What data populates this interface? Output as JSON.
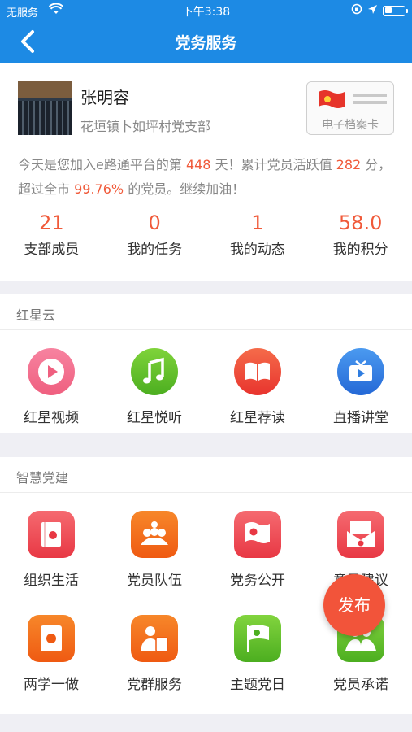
{
  "status_bar": {
    "carrier": "无服务",
    "time": "下午3:38"
  },
  "nav": {
    "title": "党务服务"
  },
  "profile": {
    "name": "张明容",
    "branch": "花垣镇卜如坪村党支部",
    "dossier_label": "电子档案卡",
    "intro": {
      "p1": "今天是您加入e路通平台的第 ",
      "days": "448",
      "p2": " 天！累计党员活跃值 ",
      "score": "282",
      "p3": " 分，超过全市 ",
      "percent": "99.76%",
      "p4": " 的党员。继续加油！"
    },
    "stats": [
      {
        "value": "21",
        "label": "支部成员"
      },
      {
        "value": "0",
        "label": "我的任务"
      },
      {
        "value": "1",
        "label": "我的动态"
      },
      {
        "value": "58.0",
        "label": "我的积分"
      }
    ]
  },
  "sections": {
    "red_star_cloud": {
      "title": "红星云",
      "items": [
        {
          "label": "红星视频",
          "icon": "video-play-icon",
          "color": "#f26a8a"
        },
        {
          "label": "红星悦听",
          "icon": "music-note-icon",
          "color": "#5bbf2b"
        },
        {
          "label": "红星荐读",
          "icon": "open-book-icon",
          "color": "#f0463a"
        },
        {
          "label": "直播讲堂",
          "icon": "tv-live-icon",
          "color": "#2f7de0"
        }
      ]
    },
    "smart_party": {
      "title": "智慧党建",
      "items": [
        {
          "label": "组织生活",
          "icon": "party-book-icon",
          "color": "#f04a55"
        },
        {
          "label": "党员队伍",
          "icon": "party-members-icon",
          "color": "#f26a1a"
        },
        {
          "label": "党务公开",
          "icon": "party-flag-icon",
          "color": "#f04a55"
        },
        {
          "label": "意见建议",
          "icon": "suggestion-mail-icon",
          "color": "#f04a55"
        },
        {
          "label": "两学一做",
          "icon": "study-book-icon",
          "color": "#f26a1a"
        },
        {
          "label": "党群服务",
          "icon": "service-person-icon",
          "color": "#f26a1a"
        },
        {
          "label": "主题党日",
          "icon": "green-flag-icon",
          "color": "#5bbf2b"
        },
        {
          "label": "党员承诺",
          "icon": "promise-people-icon",
          "color": "#5bbf2b"
        }
      ]
    }
  },
  "fab": {
    "label": "发布"
  }
}
